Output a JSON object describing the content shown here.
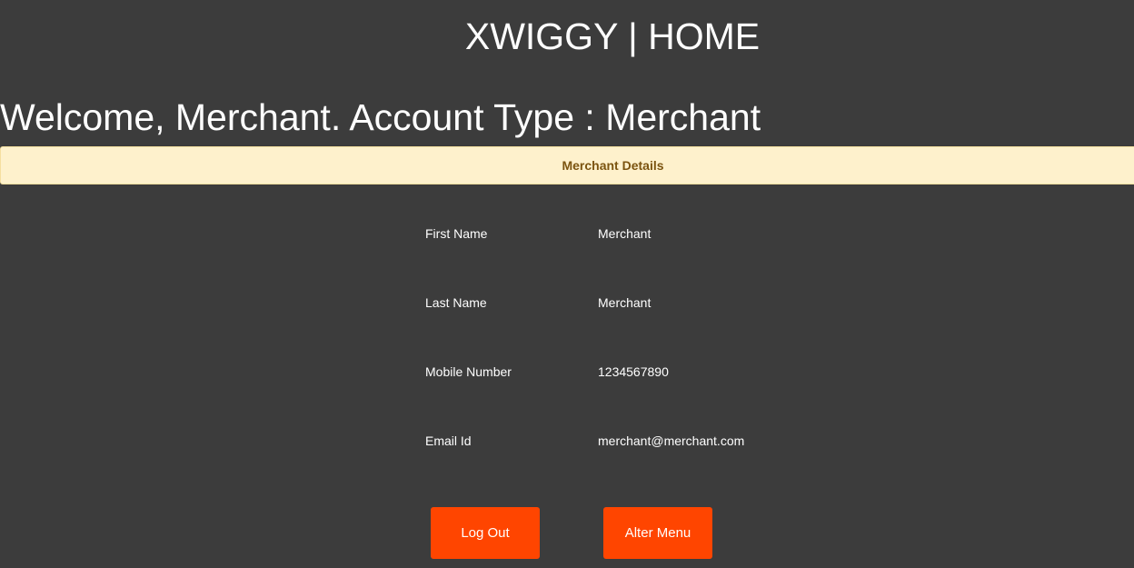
{
  "header": {
    "title": "XWIGGY | HOME"
  },
  "welcome": {
    "text": "Welcome, Merchant. Account Type : Merchant"
  },
  "details_banner": {
    "label": "Merchant Details",
    "background": "#fef1cc",
    "text_color": "#7b5410"
  },
  "details": [
    {
      "label": "First Name",
      "value": "Merchant"
    },
    {
      "label": "Last Name",
      "value": "Merchant"
    },
    {
      "label": "Mobile Number",
      "value": "1234567890"
    },
    {
      "label": "Email Id",
      "value": "merchant@merchant.com"
    }
  ],
  "actions": {
    "logout_label": "Log Out",
    "alter_menu_label": "Alter Menu",
    "button_color": "#ff4500"
  },
  "theme": {
    "page_background": "#3c3c3c",
    "text_color": "#ffffff"
  }
}
